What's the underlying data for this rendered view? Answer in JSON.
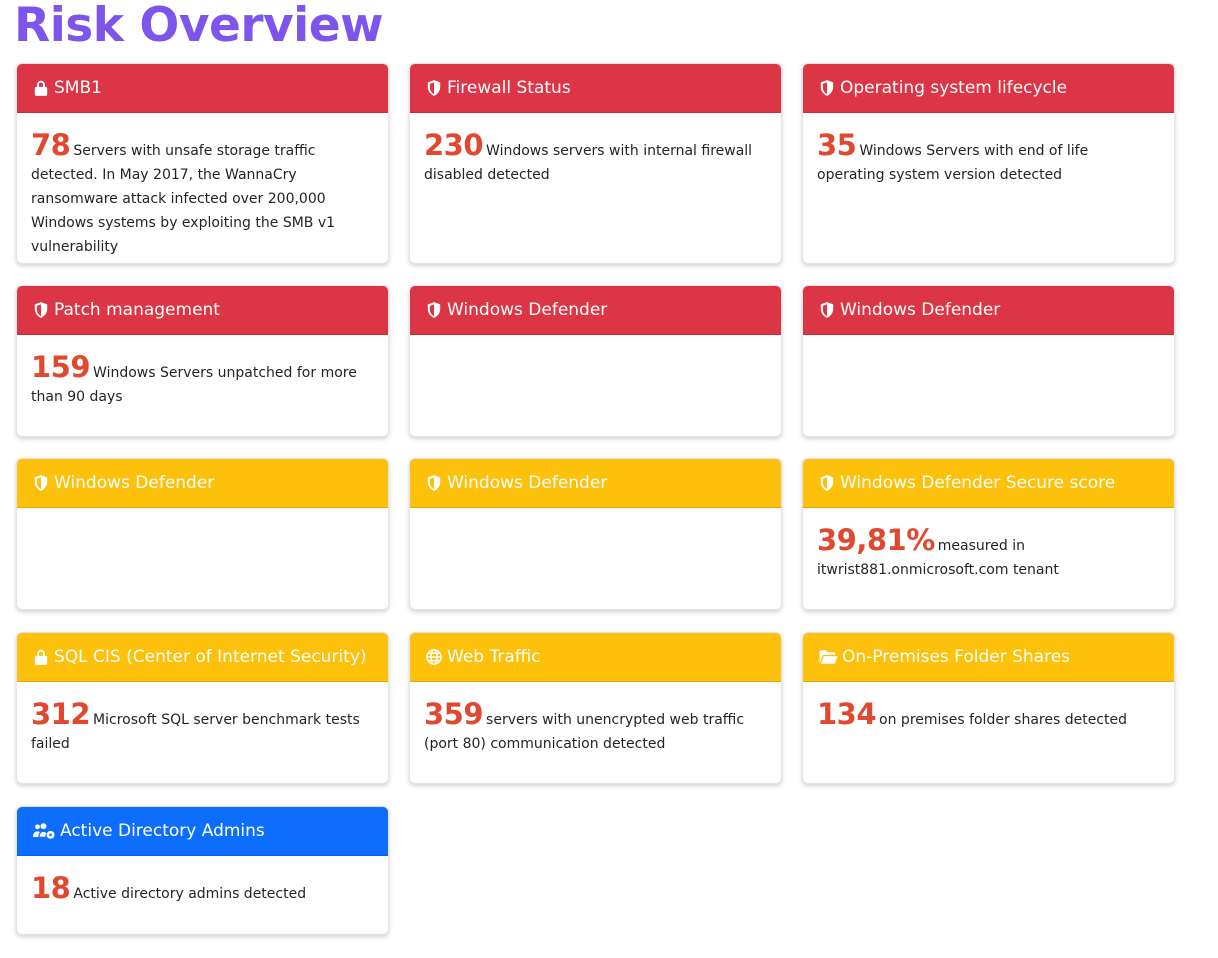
{
  "page": {
    "title": "Risk Overview"
  },
  "colors": {
    "title": "#7e55ea",
    "red": "#dc3545",
    "yellow": "#fec10b",
    "blue": "#0d6efd",
    "number": "#e0482f"
  },
  "cards": [
    {
      "title": "SMB1",
      "icon": "lock-icon",
      "color": "red",
      "number": "78",
      "text": "Servers with unsafe storage traffic detected. In May 2017, the WannaCry ransomware attack infected over 200,000 Windows systems by exploiting the SMB v1 vulnerability"
    },
    {
      "title": "Firewall Status",
      "icon": "shield-icon",
      "color": "red",
      "number": "230",
      "text": "Windows servers with internal firewall disabled detected"
    },
    {
      "title": "Operating system lifecycle",
      "icon": "shield-icon",
      "color": "red",
      "number": "35",
      "text": "Windows Servers with end of life operating system version detected"
    },
    {
      "title": "Patch management",
      "icon": "shield-icon",
      "color": "red",
      "number": "159",
      "text": "Windows Servers unpatched for more than 90 days"
    },
    {
      "title": "Windows Defender",
      "icon": "shield-icon",
      "color": "red"
    },
    {
      "title": "Windows Defender",
      "icon": "shield-icon",
      "color": "red"
    },
    {
      "title": "Windows Defender",
      "icon": "shield-icon",
      "color": "yellow"
    },
    {
      "title": "Windows Defender",
      "icon": "shield-icon",
      "color": "yellow"
    },
    {
      "title": "Windows Defender Secure score",
      "icon": "shield-icon",
      "color": "yellow",
      "number": "39,81%",
      "text": "measured in itwrist881.onmicrosoft.com tenant"
    },
    {
      "title": "SQL CIS (Center of Internet Security)",
      "icon": "lock-icon",
      "color": "yellow",
      "number": "312",
      "text": "Microsoft SQL server benchmark tests failed"
    },
    {
      "title": "Web Traffic",
      "icon": "globe-icon",
      "color": "yellow",
      "number": "359",
      "text": "servers with unencrypted web traffic (port 80) communication detected"
    },
    {
      "title": "On-Premises Folder Shares",
      "icon": "folder-open-icon",
      "color": "yellow",
      "number": "134",
      "text": "on premises folder shares detected"
    },
    {
      "title": "Active Directory Admins",
      "icon": "users-cog-icon",
      "color": "blue",
      "number": "18",
      "text": "Active directory admins detected"
    }
  ]
}
